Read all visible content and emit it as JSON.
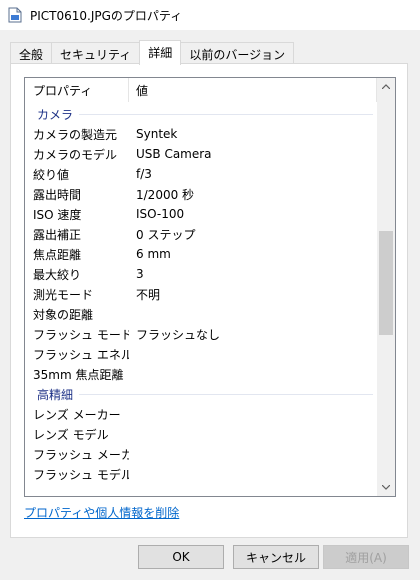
{
  "window": {
    "title": "PICT0610.JPGのプロパティ"
  },
  "tabs": [
    {
      "label": "全般"
    },
    {
      "label": "セキュリティ"
    },
    {
      "label": "詳細"
    },
    {
      "label": "以前のバージョン"
    }
  ],
  "list": {
    "header": {
      "property": "プロパティ",
      "value": "値"
    },
    "groups": [
      {
        "label": "カメラ",
        "rows": [
          {
            "name": "カメラの製造元",
            "value": "Syntek"
          },
          {
            "name": "カメラのモデル",
            "value": "USB Camera"
          },
          {
            "name": "絞り値",
            "value": "f/3"
          },
          {
            "name": "露出時間",
            "value": "1/2000 秒"
          },
          {
            "name": "ISO 速度",
            "value": "ISO-100"
          },
          {
            "name": "露出補正",
            "value": "0 ステップ"
          },
          {
            "name": "焦点距離",
            "value": "6 mm"
          },
          {
            "name": "最大絞り",
            "value": "3"
          },
          {
            "name": "測光モード",
            "value": "不明"
          },
          {
            "name": "対象の距離",
            "value": ""
          },
          {
            "name": "フラッシュ モード",
            "value": "フラッシュなし"
          },
          {
            "name": "フラッシュ エネルギー",
            "value": ""
          },
          {
            "name": "35mm 焦点距離",
            "value": ""
          }
        ]
      },
      {
        "label": "高精細",
        "rows": [
          {
            "name": "レンズ メーカー",
            "value": ""
          },
          {
            "name": "レンズ モデル",
            "value": ""
          },
          {
            "name": "フラッシュ メーカー",
            "value": ""
          },
          {
            "name": "フラッシュ モデル",
            "value": ""
          }
        ]
      }
    ]
  },
  "remove_link": "プロパティや個人情報を削除",
  "buttons": {
    "ok": "OK",
    "cancel": "キャンセル",
    "apply": "適用(A)"
  },
  "colors": {
    "link": "#0066cc",
    "group_header": "#1e3287",
    "active_tab": "#ffffff"
  },
  "icons": {
    "title": "document-icon",
    "scroll_up": "chevron-up-icon",
    "scroll_down": "chevron-down-icon"
  }
}
